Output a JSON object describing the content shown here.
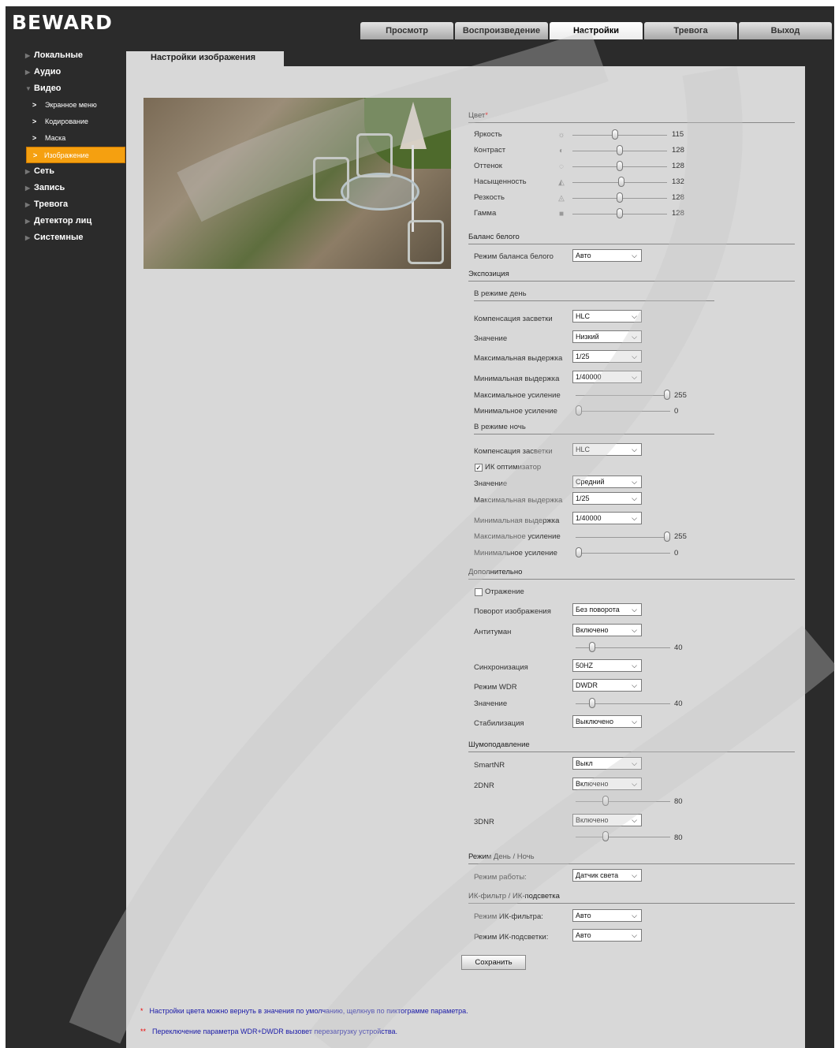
{
  "logo": "BEWARD",
  "tabs": [
    "Просмотр",
    "Воспроизведение",
    "Настройки",
    "Тревога",
    "Выход"
  ],
  "sidebar": {
    "items": [
      "Локальные",
      "Аудио",
      "Видео"
    ],
    "video_sub": [
      "Экранное меню",
      "Кодирование",
      "Маска",
      "Изображение"
    ],
    "items2": [
      "Сеть",
      "Запись",
      "Тревога",
      "Детектор лиц",
      "Системные"
    ]
  },
  "page_title": "Настройки изображения",
  "color": {
    "title": "Цвет",
    "star": "*",
    "rows": [
      {
        "label": "Яркость",
        "value": "115",
        "level": 0.45,
        "icon": "sun-icon"
      },
      {
        "label": "Контраст",
        "value": "128",
        "level": 0.5,
        "icon": "contrast-icon"
      },
      {
        "label": "Оттенок",
        "value": "128",
        "level": 0.5,
        "icon": "palette-icon"
      },
      {
        "label": "Насыщенность",
        "value": "132",
        "level": 0.52,
        "icon": "saturation-icon"
      },
      {
        "label": "Резкость",
        "value": "128",
        "level": 0.5,
        "icon": "sharpness-icon"
      },
      {
        "label": "Гамма",
        "value": "128",
        "level": 0.5,
        "icon": "gamma-icon"
      }
    ]
  },
  "wb": {
    "title": "Баланс белого",
    "label": "Режим баланса белого",
    "value": "Авто"
  },
  "exposure": {
    "title": "Экспозиция",
    "day": {
      "title": "В режиме день",
      "backlight_label": "Компенсация засветки",
      "backlight": "HLC",
      "level_label": "Значение",
      "level": "Низкий",
      "max_shutter_label": "Максимальная выдержка",
      "max_shutter": "1/25",
      "min_shutter_label": "Минимальная выдержка",
      "min_shutter": "1/40000",
      "max_gain_label": "Максимальное усиление",
      "max_gain": "255",
      "min_gain_label": "Минимальное усиление",
      "min_gain": "0"
    },
    "night": {
      "title": "В режиме ночь",
      "backlight_label": "Компенсация засветки",
      "backlight": "HLC",
      "ir_opt_label": "ИК оптимизатор",
      "ir_opt_checked": true,
      "level_label": "Значение",
      "level": "Средний",
      "max_shutter_label": "Максимальная выдержка",
      "max_shutter": "1/25",
      "min_shutter_label": "Минимальная выдержка",
      "min_shutter": "1/40000",
      "max_gain_label": "Максимальное усиление",
      "max_gain": "255",
      "min_gain_label": "Минимальное усиление",
      "min_gain": "0"
    }
  },
  "extra": {
    "title": "Дополнительно",
    "mirror_label": "Отражение",
    "mirror_checked": false,
    "rotate_label": "Поворот изображения",
    "rotate": "Без поворота",
    "defog_label": "Антитуман",
    "defog": "Включено",
    "defog_value": "40",
    "sync_label": "Синхронизация",
    "sync": "50HZ",
    "wdr_label": "Режим WDR",
    "wdr": "DWDR",
    "wdr_level_label": "Значение",
    "wdr_level": "40",
    "stab_label": "Стабилизация",
    "stab": "Выключено"
  },
  "noise": {
    "title": "Шумоподавление",
    "smartnr_label": "SmartNR",
    "smartnr": "Выкл",
    "dnr2_label": "2DNR",
    "dnr2": "Включено",
    "dnr2_value": "80",
    "dnr3_label": "3DNR",
    "dnr3": "Включено",
    "dnr3_value": "80"
  },
  "daynight": {
    "title": "Режим День / Ночь",
    "label": "Режим работы:",
    "value": "Датчик света"
  },
  "ir": {
    "title": "ИК-фильтр / ИК-подсветка",
    "filter_label": "Режим ИК-фильтра:",
    "filter": "Авто",
    "light_label": "Режим ИК-подсветки:",
    "light": "Авто"
  },
  "save_label": "Сохранить",
  "notes": [
    {
      "star": "*",
      "text": "Настройки цвета можно вернуть в значения по умолчанию, щелкнув по пиктограмме параметра."
    },
    {
      "star": "**",
      "text": "Переключение параметра WDR+DWDR вызовет перезагрузку устройства."
    }
  ],
  "colors": {
    "accent": "#f5a010",
    "frame": "#2b2b2b",
    "panel": "#d8d8d8",
    "note": "#1a1aa8"
  }
}
